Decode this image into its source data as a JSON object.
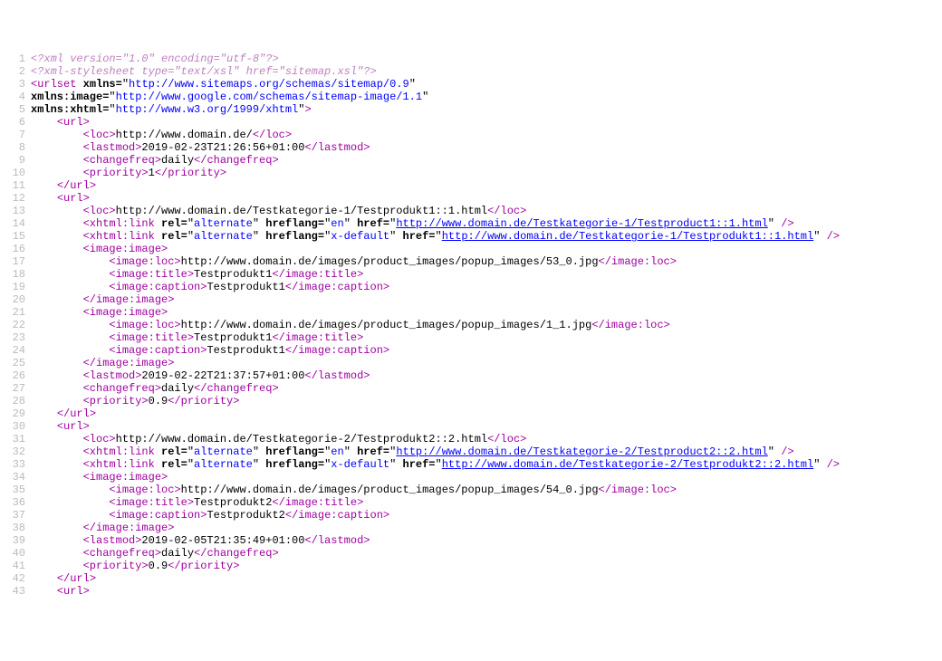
{
  "lines": [
    {
      "n": 1,
      "cls": "decl",
      "html": "<?xml version=\"1.0\" encoding=\"utf-8\"?>"
    },
    {
      "n": 2,
      "cls": "decl",
      "html": "<?xml-stylesheet type=\"text/xsl\" href=\"sitemap.xsl\"?>"
    },
    {
      "n": 3,
      "html": "<span class='tag'>&lt;urlset</span> <span class='attr'>xmlns=</span>\"<span class='val'>http://www.sitemaps.org/schemas/sitemap/0.9</span>\""
    },
    {
      "n": 4,
      "html": "<span class='attr'>xmlns:image=</span>\"<span class='val'>http://www.google.com/schemas/sitemap-image/1.1</span>\""
    },
    {
      "n": 5,
      "html": "<span class='attr'>xmlns:xhtml=</span>\"<span class='val'>http://www.w3.org/1999/xhtml</span>\"<span class='tag'>&gt;</span>"
    },
    {
      "n": 6,
      "indent": 1,
      "html": "<span class='tag'>&lt;url&gt;</span>"
    },
    {
      "n": 7,
      "indent": 2,
      "html": "<span class='tag'>&lt;loc&gt;</span><span class='txt'>http://www.domain.de/</span><span class='tag'>&lt;/loc&gt;</span>"
    },
    {
      "n": 8,
      "indent": 2,
      "html": "<span class='tag'>&lt;lastmod&gt;</span><span class='txt'>2019-02-23T21:26:56+01:00</span><span class='tag'>&lt;/lastmod&gt;</span>"
    },
    {
      "n": 9,
      "indent": 2,
      "html": "<span class='tag'>&lt;changefreq&gt;</span><span class='txt'>daily</span><span class='tag'>&lt;/changefreq&gt;</span>"
    },
    {
      "n": 10,
      "indent": 2,
      "html": "<span class='tag'>&lt;priority&gt;</span><span class='txt'>1</span><span class='tag'>&lt;/priority&gt;</span>"
    },
    {
      "n": 11,
      "indent": 1,
      "html": "<span class='tag'>&lt;/url&gt;</span>"
    },
    {
      "n": 12,
      "indent": 1,
      "html": "<span class='tag'>&lt;url&gt;</span>"
    },
    {
      "n": 13,
      "indent": 2,
      "html": "<span class='tag'>&lt;loc&gt;</span><span class='txt'>http://www.domain.de/Testkategorie-1/Testprodukt1::1.html</span><span class='tag'>&lt;/loc&gt;</span>"
    },
    {
      "n": 14,
      "indent": 2,
      "html": "<span class='tag'>&lt;xhtml:link</span> <span class='attr'>rel=</span>\"<span class='val'>alternate</span>\" <span class='attr'>hreflang=</span>\"<span class='val'>en</span>\" <span class='attr'>href=</span>\"<span class='url'>http://www.domain.de/Testkategorie-1/Testproduct1::1.html</span>\" <span class='tag'>/&gt;</span>"
    },
    {
      "n": 15,
      "indent": 2,
      "html": "<span class='tag'>&lt;xhtml:link</span> <span class='attr'>rel=</span>\"<span class='val'>alternate</span>\" <span class='attr'>hreflang=</span>\"<span class='val'>x-default</span>\" <span class='attr'>href=</span>\"<span class='url'>http://www.domain.de/Testkategorie-1/Testprodukt1::1.html</span>\" <span class='tag'>/&gt;</span>"
    },
    {
      "n": 16,
      "indent": 2,
      "html": "<span class='tag'>&lt;image:image&gt;</span>"
    },
    {
      "n": 17,
      "indent": 3,
      "html": "<span class='tag'>&lt;image:loc&gt;</span><span class='txt'>http://www.domain.de/images/product_images/popup_images/53_0.jpg</span><span class='tag'>&lt;/image:loc&gt;</span>"
    },
    {
      "n": 18,
      "indent": 3,
      "html": "<span class='tag'>&lt;image:title&gt;</span><span class='txt'>Testprodukt1</span><span class='tag'>&lt;/image:title&gt;</span>"
    },
    {
      "n": 19,
      "indent": 3,
      "html": "<span class='tag'>&lt;image:caption&gt;</span><span class='txt'>Testprodukt1</span><span class='tag'>&lt;/image:caption&gt;</span>"
    },
    {
      "n": 20,
      "indent": 2,
      "html": "<span class='tag'>&lt;/image:image&gt;</span>"
    },
    {
      "n": 21,
      "indent": 2,
      "html": "<span class='tag'>&lt;image:image&gt;</span>"
    },
    {
      "n": 22,
      "indent": 3,
      "html": "<span class='tag'>&lt;image:loc&gt;</span><span class='txt'>http://www.domain.de/images/product_images/popup_images/1_1.jpg</span><span class='tag'>&lt;/image:loc&gt;</span>"
    },
    {
      "n": 23,
      "indent": 3,
      "html": "<span class='tag'>&lt;image:title&gt;</span><span class='txt'>Testprodukt1</span><span class='tag'>&lt;/image:title&gt;</span>"
    },
    {
      "n": 24,
      "indent": 3,
      "html": "<span class='tag'>&lt;image:caption&gt;</span><span class='txt'>Testprodukt1</span><span class='tag'>&lt;/image:caption&gt;</span>"
    },
    {
      "n": 25,
      "indent": 2,
      "html": "<span class='tag'>&lt;/image:image&gt;</span>"
    },
    {
      "n": 26,
      "indent": 2,
      "html": "<span class='tag'>&lt;lastmod&gt;</span><span class='txt'>2019-02-22T21:37:57+01:00</span><span class='tag'>&lt;/lastmod&gt;</span>"
    },
    {
      "n": 27,
      "indent": 2,
      "html": "<span class='tag'>&lt;changefreq&gt;</span><span class='txt'>daily</span><span class='tag'>&lt;/changefreq&gt;</span>"
    },
    {
      "n": 28,
      "indent": 2,
      "html": "<span class='tag'>&lt;priority&gt;</span><span class='txt'>0.9</span><span class='tag'>&lt;/priority&gt;</span>"
    },
    {
      "n": 29,
      "indent": 1,
      "html": "<span class='tag'>&lt;/url&gt;</span>"
    },
    {
      "n": 30,
      "indent": 1,
      "html": "<span class='tag'>&lt;url&gt;</span>"
    },
    {
      "n": 31,
      "indent": 2,
      "html": "<span class='tag'>&lt;loc&gt;</span><span class='txt'>http://www.domain.de/Testkategorie-2/Testprodukt2::2.html</span><span class='tag'>&lt;/loc&gt;</span>"
    },
    {
      "n": 32,
      "indent": 2,
      "html": "<span class='tag'>&lt;xhtml:link</span> <span class='attr'>rel=</span>\"<span class='val'>alternate</span>\" <span class='attr'>hreflang=</span>\"<span class='val'>en</span>\" <span class='attr'>href=</span>\"<span class='url'>http://www.domain.de/Testkategorie-2/Testproduct2::2.html</span>\" <span class='tag'>/&gt;</span>"
    },
    {
      "n": 33,
      "indent": 2,
      "html": "<span class='tag'>&lt;xhtml:link</span> <span class='attr'>rel=</span>\"<span class='val'>alternate</span>\" <span class='attr'>hreflang=</span>\"<span class='val'>x-default</span>\" <span class='attr'>href=</span>\"<span class='url'>http://www.domain.de/Testkategorie-2/Testprodukt2::2.html</span>\" <span class='tag'>/&gt;</span>"
    },
    {
      "n": 34,
      "indent": 2,
      "html": "<span class='tag'>&lt;image:image&gt;</span>"
    },
    {
      "n": 35,
      "indent": 3,
      "html": "<span class='tag'>&lt;image:loc&gt;</span><span class='txt'>http://www.domain.de/images/product_images/popup_images/54_0.jpg</span><span class='tag'>&lt;/image:loc&gt;</span>"
    },
    {
      "n": 36,
      "indent": 3,
      "html": "<span class='tag'>&lt;image:title&gt;</span><span class='txt'>Testprodukt2</span><span class='tag'>&lt;/image:title&gt;</span>"
    },
    {
      "n": 37,
      "indent": 3,
      "html": "<span class='tag'>&lt;image:caption&gt;</span><span class='txt'>Testprodukt2</span><span class='tag'>&lt;/image:caption&gt;</span>"
    },
    {
      "n": 38,
      "indent": 2,
      "html": "<span class='tag'>&lt;/image:image&gt;</span>"
    },
    {
      "n": 39,
      "indent": 2,
      "html": "<span class='tag'>&lt;lastmod&gt;</span><span class='txt'>2019-02-05T21:35:49+01:00</span><span class='tag'>&lt;/lastmod&gt;</span>"
    },
    {
      "n": 40,
      "indent": 2,
      "html": "<span class='tag'>&lt;changefreq&gt;</span><span class='txt'>daily</span><span class='tag'>&lt;/changefreq&gt;</span>"
    },
    {
      "n": 41,
      "indent": 2,
      "html": "<span class='tag'>&lt;priority&gt;</span><span class='txt'>0.9</span><span class='tag'>&lt;/priority&gt;</span>"
    },
    {
      "n": 42,
      "indent": 1,
      "html": "<span class='tag'>&lt;/url&gt;</span>"
    },
    {
      "n": 43,
      "indent": 1,
      "html": "<span class='tag'>&lt;url&gt;</span>"
    }
  ],
  "indentUnit": "    "
}
